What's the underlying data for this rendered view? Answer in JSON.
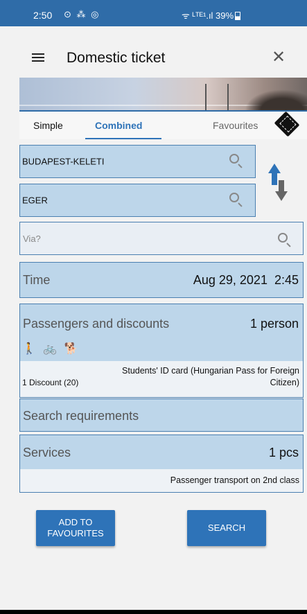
{
  "status": {
    "time": "2:50",
    "left_icons": "⊙ ⁂ ◎",
    "right_text": "ᯤ ᴸᵀᴱ¹.ıl 39%"
  },
  "app_bar": {
    "title": "Domestic ticket",
    "menu_icon": "hamburger-menu-icon",
    "close_icon": "close-icon"
  },
  "tabs": [
    {
      "label": "Simple"
    },
    {
      "label": "Combined"
    },
    {
      "label": "Favourites"
    }
  ],
  "route": {
    "from": "BUDAPEST-KELETI",
    "to": "EGER",
    "via_placeholder": "Via?"
  },
  "time": {
    "label": "Time",
    "value": "Aug 29, 2021  2:45"
  },
  "passengers": {
    "label": "Passengers and discounts",
    "value": "1 person",
    "icons": "🚶 🚲 🐕",
    "discount_count": "1 Discount (20)",
    "discount_desc": "Students' ID card (Hungarian Pass for Foreign Citizen)"
  },
  "requirements": {
    "label": "Search requirements"
  },
  "services": {
    "label": "Services",
    "value": "1 pcs",
    "desc": "Passenger transport on 2nd class"
  },
  "buttons": {
    "add_favourites": "ADD TO FAVOURITES",
    "search": "SEARCH"
  },
  "colors": {
    "accent": "#2e73b8",
    "status_bar": "#2f6ca8",
    "field_bg": "#bdd6ea"
  }
}
